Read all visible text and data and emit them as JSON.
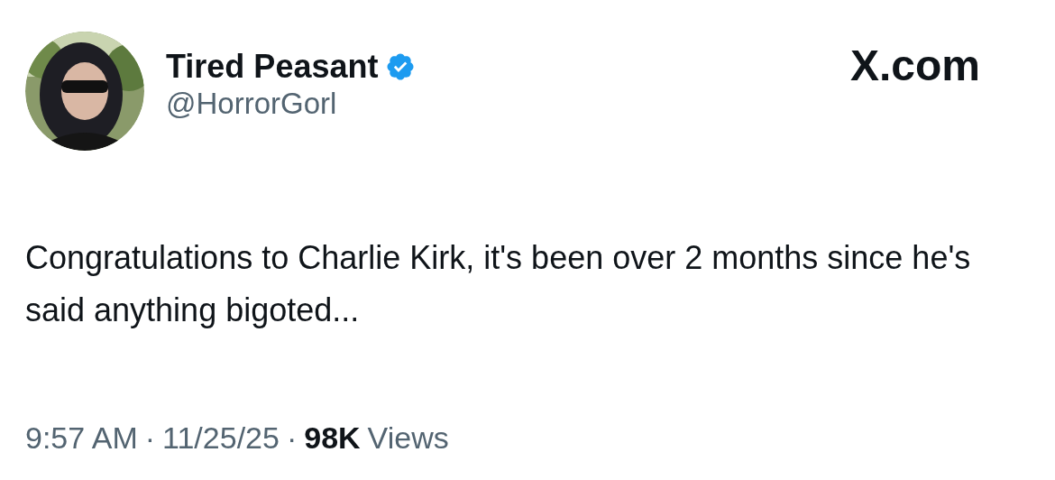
{
  "author": {
    "name": "Tired Peasant",
    "verified": true,
    "handle": "@HorrorGorl"
  },
  "site": "X.com",
  "text": "Congratulations to Charlie Kirk, it's been over 2 months since he's said anything bigoted...",
  "meta": {
    "time": "9:57 AM",
    "separator_1": "·",
    "date": "11/25/25",
    "separator_2": "·",
    "views_count": "98K",
    "views_label": "Views"
  }
}
